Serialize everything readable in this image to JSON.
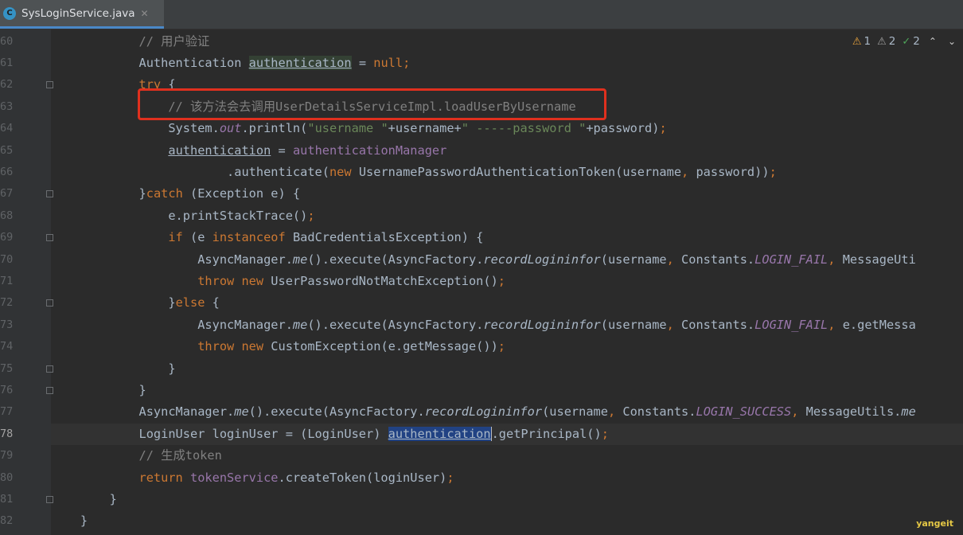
{
  "tab": {
    "icon_letter": "C",
    "file_name": "SysLoginService.java",
    "close_glyph": "✕"
  },
  "inspections": {
    "warnings": "1",
    "weak_warnings": "2",
    "typos": "2"
  },
  "watermark": "yangeit",
  "current_line": "78",
  "lines": [
    {
      "num": "60",
      "fold": false,
      "tokens": [
        {
          "cls": "com",
          "text": "            // 用户验证"
        }
      ]
    },
    {
      "num": "61",
      "fold": false,
      "tokens": [
        {
          "cls": "",
          "text": "            Authentication "
        },
        {
          "cls": "under",
          "text": "authentication"
        },
        {
          "cls": "",
          "text": " = "
        },
        {
          "cls": "nullv",
          "text": "null"
        },
        {
          "cls": "kw",
          "text": ";"
        }
      ]
    },
    {
      "num": "62",
      "fold": true,
      "tokens": [
        {
          "cls": "kw",
          "text": "            try"
        },
        {
          "cls": "",
          "text": " {"
        }
      ]
    },
    {
      "num": "63",
      "fold": false,
      "tokens": [
        {
          "cls": "com",
          "text": "                // 该方法会去调用UserDetailsServiceImpl.loadUserByUsername"
        }
      ]
    },
    {
      "num": "64",
      "fold": false,
      "tokens": [
        {
          "cls": "",
          "text": "                System."
        },
        {
          "cls": "fldi",
          "text": "out"
        },
        {
          "cls": "",
          "text": ".println("
        },
        {
          "cls": "str",
          "text": "\"username \""
        },
        {
          "cls": "",
          "text": "+username+"
        },
        {
          "cls": "str",
          "text": "\" -----password \""
        },
        {
          "cls": "",
          "text": "+password)"
        },
        {
          "cls": "kw",
          "text": ";"
        }
      ]
    },
    {
      "num": "65",
      "fold": false,
      "tokens": [
        {
          "cls": "",
          "text": "                "
        },
        {
          "cls": "under2",
          "text": "authentication"
        },
        {
          "cls": "",
          "text": " = "
        },
        {
          "cls": "fld",
          "text": "authenticationManager"
        }
      ]
    },
    {
      "num": "66",
      "fold": false,
      "tokens": [
        {
          "cls": "",
          "text": "                        .authenticate("
        },
        {
          "cls": "kw",
          "text": "new "
        },
        {
          "cls": "",
          "text": "UsernamePasswordAuthenticationToken(username"
        },
        {
          "cls": "kw",
          "text": ", "
        },
        {
          "cls": "",
          "text": "password))"
        },
        {
          "cls": "kw",
          "text": ";"
        }
      ]
    },
    {
      "num": "67",
      "fold": true,
      "tokens": [
        {
          "cls": "",
          "text": "            }"
        },
        {
          "cls": "kw",
          "text": "catch "
        },
        {
          "cls": "",
          "text": "(Exception e) {"
        }
      ]
    },
    {
      "num": "68",
      "fold": false,
      "tokens": [
        {
          "cls": "",
          "text": "                e.printStackTrace()"
        },
        {
          "cls": "kw",
          "text": ";"
        }
      ]
    },
    {
      "num": "69",
      "fold": true,
      "tokens": [
        {
          "cls": "kw",
          "text": "                if "
        },
        {
          "cls": "",
          "text": "(e "
        },
        {
          "cls": "kw",
          "text": "instanceof "
        },
        {
          "cls": "",
          "text": "BadCredentialsException) {"
        }
      ]
    },
    {
      "num": "70",
      "fold": false,
      "tokens": [
        {
          "cls": "",
          "text": "                    AsyncManager."
        },
        {
          "cls": "ital",
          "text": "me"
        },
        {
          "cls": "",
          "text": "().execute(AsyncFactory."
        },
        {
          "cls": "ital",
          "text": "recordLogininfor"
        },
        {
          "cls": "",
          "text": "(username"
        },
        {
          "cls": "kw",
          "text": ", "
        },
        {
          "cls": "",
          "text": "Constants."
        },
        {
          "cls": "fldi",
          "text": "LOGIN_FAIL"
        },
        {
          "cls": "kw",
          "text": ", "
        },
        {
          "cls": "",
          "text": "MessageUti"
        }
      ]
    },
    {
      "num": "71",
      "fold": false,
      "tokens": [
        {
          "cls": "kw",
          "text": "                    throw new "
        },
        {
          "cls": "",
          "text": "UserPasswordNotMatchException()"
        },
        {
          "cls": "kw",
          "text": ";"
        }
      ]
    },
    {
      "num": "72",
      "fold": true,
      "tokens": [
        {
          "cls": "",
          "text": "                }"
        },
        {
          "cls": "kw",
          "text": "else "
        },
        {
          "cls": "",
          "text": "{"
        }
      ]
    },
    {
      "num": "73",
      "fold": false,
      "tokens": [
        {
          "cls": "",
          "text": "                    AsyncManager."
        },
        {
          "cls": "ital",
          "text": "me"
        },
        {
          "cls": "",
          "text": "().execute(AsyncFactory."
        },
        {
          "cls": "ital",
          "text": "recordLogininfor"
        },
        {
          "cls": "",
          "text": "(username"
        },
        {
          "cls": "kw",
          "text": ", "
        },
        {
          "cls": "",
          "text": "Constants."
        },
        {
          "cls": "fldi",
          "text": "LOGIN_FAIL"
        },
        {
          "cls": "kw",
          "text": ", "
        },
        {
          "cls": "",
          "text": "e.getMessa"
        }
      ]
    },
    {
      "num": "74",
      "fold": false,
      "tokens": [
        {
          "cls": "kw",
          "text": "                    throw new "
        },
        {
          "cls": "",
          "text": "CustomException(e.getMessage())"
        },
        {
          "cls": "kw",
          "text": ";"
        }
      ]
    },
    {
      "num": "75",
      "fold": true,
      "tokens": [
        {
          "cls": "",
          "text": "                }"
        }
      ]
    },
    {
      "num": "76",
      "fold": true,
      "tokens": [
        {
          "cls": "",
          "text": "            }"
        }
      ]
    },
    {
      "num": "77",
      "fold": false,
      "tokens": [
        {
          "cls": "",
          "text": "            AsyncManager."
        },
        {
          "cls": "ital",
          "text": "me"
        },
        {
          "cls": "",
          "text": "().execute(AsyncFactory."
        },
        {
          "cls": "ital",
          "text": "recordLogininfor"
        },
        {
          "cls": "",
          "text": "(username"
        },
        {
          "cls": "kw",
          "text": ", "
        },
        {
          "cls": "",
          "text": "Constants."
        },
        {
          "cls": "fldi",
          "text": "LOGIN_SUCCESS"
        },
        {
          "cls": "kw",
          "text": ", "
        },
        {
          "cls": "",
          "text": "MessageUtils."
        },
        {
          "cls": "ital",
          "text": "me"
        }
      ]
    },
    {
      "num": "78",
      "fold": false,
      "tokens": [
        {
          "cls": "",
          "text": "            LoginUser loginUser = (LoginUser) "
        },
        {
          "cls": "sel",
          "text": "authentication"
        },
        {
          "cls": "caret",
          "text": ""
        },
        {
          "cls": "",
          "text": ".getPrincipal()"
        },
        {
          "cls": "kw",
          "text": ";"
        }
      ]
    },
    {
      "num": "79",
      "fold": false,
      "tokens": [
        {
          "cls": "com",
          "text": "            // 生成token"
        }
      ]
    },
    {
      "num": "80",
      "fold": false,
      "tokens": [
        {
          "cls": "kw",
          "text": "            return "
        },
        {
          "cls": "fld",
          "text": "tokenService"
        },
        {
          "cls": "",
          "text": ".createToken(loginUser)"
        },
        {
          "cls": "kw",
          "text": ";"
        }
      ]
    },
    {
      "num": "81",
      "fold": true,
      "tokens": [
        {
          "cls": "",
          "text": "        }"
        }
      ]
    },
    {
      "num": "82",
      "fold": false,
      "tokens": [
        {
          "cls": "",
          "text": "    }"
        }
      ]
    }
  ]
}
